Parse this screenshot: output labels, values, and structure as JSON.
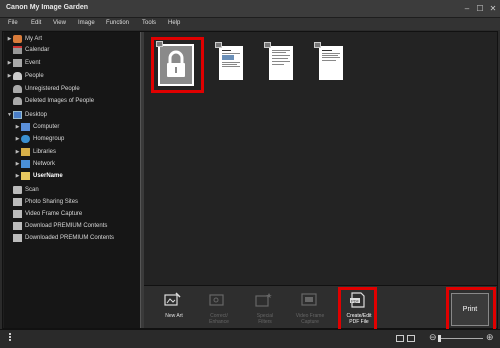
{
  "window": {
    "title": "Canon My Image Garden"
  },
  "menu": [
    "File",
    "Edit",
    "View",
    "Image",
    "Function",
    "Tools",
    "Help"
  ],
  "sidebar": {
    "items": [
      {
        "label": "My Art",
        "icon": "my-art-icon",
        "arrow": "▶",
        "color": "#d97b3a"
      },
      {
        "label": "Calendar",
        "icon": "calendar-icon",
        "arrow": "",
        "color": "#aaaaaa"
      },
      {
        "label": "Event",
        "icon": "event-icon",
        "arrow": "▶",
        "color": "#aaaaaa"
      },
      {
        "label": "People",
        "icon": "people-icon",
        "arrow": "▶",
        "color": "#cccccc"
      },
      {
        "label": "Unregistered People",
        "icon": "unregistered-people-icon",
        "arrow": "",
        "color": "#aaaaaa"
      },
      {
        "label": "Deleted Images of People",
        "icon": "deleted-people-icon",
        "arrow": "",
        "color": "#aaaaaa"
      },
      {
        "label": "Desktop",
        "icon": "desktop-icon",
        "arrow": "▼",
        "color": "#4a7fc8"
      },
      {
        "label": "Computer",
        "icon": "computer-icon",
        "arrow": "▶",
        "color": "#5a8fd8"
      },
      {
        "label": "Homegroup",
        "icon": "homegroup-icon",
        "arrow": "▶",
        "color": "#3a8fd0"
      },
      {
        "label": "Libraries",
        "icon": "libraries-icon",
        "arrow": "▶",
        "color": "#d8b048"
      },
      {
        "label": "Network",
        "icon": "network-icon",
        "arrow": "▶",
        "color": "#4a90d8"
      },
      {
        "label": "UserName",
        "icon": "user-folder-icon",
        "arrow": "▶",
        "color": "#e8c860"
      },
      {
        "label": "Scan",
        "icon": "scan-icon",
        "arrow": "",
        "color": "#bbbbbb"
      },
      {
        "label": "Photo Sharing Sites",
        "icon": "photo-sharing-icon",
        "arrow": "",
        "color": "#bbbbbb"
      },
      {
        "label": "Video Frame Capture",
        "icon": "video-capture-icon",
        "arrow": "",
        "color": "#bbbbbb"
      },
      {
        "label": "Download PREMIUM Contents",
        "icon": "download-premium-icon",
        "arrow": "",
        "color": "#bbbbbb"
      },
      {
        "label": "Downloaded PREMIUM Contents",
        "icon": "downloaded-premium-icon",
        "arrow": "",
        "color": "#bbbbbb"
      }
    ]
  },
  "toolbar": {
    "new_art": "New Art",
    "correct_enhance": "Correct/\nEnhance",
    "special_filters": "Special\nFilters",
    "video_frame_capture": "Video Frame\nCapture",
    "create_edit_pdf": "Create/Edit\nPDF File",
    "print": "Print"
  },
  "colors": {
    "highlight": "#e00000",
    "background": "#232323"
  }
}
